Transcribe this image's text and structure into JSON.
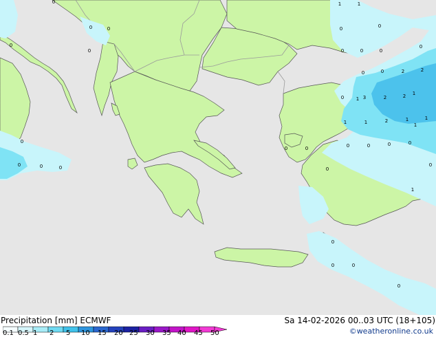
{
  "title": "Precipitation [mm]  ECMWF",
  "datetime": "Sa 14-02-2026 00..03 UTC (18+105)",
  "credit": "©weatheronline.co.uk",
  "colors": {
    "sea": "#e6e6e6",
    "land": "#ccf5a6",
    "border": "#9a9a9a",
    "coast": "#555555",
    "precip_light": "#c8f5fb",
    "precip_mid": "#7fe3f5",
    "precip_heavy": "#4cc2ec"
  },
  "legend": {
    "labels": [
      "0.1",
      "0.5",
      "1",
      "2",
      "5",
      "10",
      "15",
      "20",
      "25",
      "30",
      "35",
      "40",
      "45",
      "50"
    ],
    "colors": [
      "#f5fdff",
      "#d6f6fb",
      "#a8ecf7",
      "#6fdaf2",
      "#40c2ea",
      "#2e95de",
      "#2a67cf",
      "#2442bd",
      "#1c22a3",
      "#6a1ec4",
      "#9a18c8",
      "#c214c8",
      "#e016c6",
      "#f23ad4"
    ]
  },
  "precip_labels": [
    "1",
    "1",
    "0",
    "0",
    "0",
    "0",
    "0",
    "0",
    "0",
    "0",
    "0",
    "0",
    "0",
    "0",
    "2",
    "2",
    "0",
    "1",
    "0",
    "1",
    "2",
    "3",
    "2",
    "1",
    "1",
    "2",
    "1",
    "1",
    "1",
    "0",
    "0",
    "0",
    "0",
    "0",
    "0",
    "0",
    "0",
    "0",
    "0",
    "1",
    "0",
    "0",
    "0",
    "0",
    "0",
    "0"
  ]
}
